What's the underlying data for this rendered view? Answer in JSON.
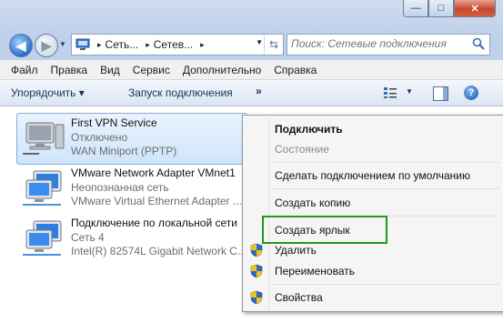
{
  "window": {
    "caption": {
      "minimize": "—",
      "maximize": "□",
      "close": "✕"
    }
  },
  "nav": {
    "back_icon": "arrow-left",
    "forward_icon": "arrow-right"
  },
  "address": {
    "crumbs": [
      "Сеть...",
      "Сетев..."
    ],
    "separator": "▸"
  },
  "search": {
    "placeholder": "Поиск: Сетевые подключения"
  },
  "menubar": [
    "Файл",
    "Правка",
    "Вид",
    "Сервис",
    "Дополнительно",
    "Справка"
  ],
  "commandbar": {
    "organize": "Упорядочить ▾",
    "connect": "Запуск подключения",
    "more": "»"
  },
  "connections": [
    {
      "name": "First VPN Service",
      "status": "Отключено",
      "device": "WAN Miniport (PPTP)",
      "icon": "vpn-computer-icon",
      "selected": true
    },
    {
      "name": "VMware Network Adapter VMnet1",
      "status": "Неопознанная сеть",
      "device": "VMware Virtual Ethernet Adapter ...",
      "icon": "network-adapter-icon",
      "selected": false
    },
    {
      "name": "Подключение по локальной сети",
      "status": "Сеть  4",
      "device": "Intel(R) 82574L Gigabit Network C...",
      "icon": "network-adapter-icon",
      "selected": false
    }
  ],
  "context_menu": {
    "items": [
      {
        "label": "Подключить",
        "bold": true,
        "disabled": false,
        "shield": false
      },
      {
        "label": "Состояние",
        "bold": false,
        "disabled": true,
        "shield": false
      },
      {
        "label": "Сделать подключением по умолчанию",
        "bold": false,
        "disabled": false,
        "shield": false
      },
      {
        "label": "Создать копию",
        "bold": false,
        "disabled": false,
        "shield": false
      },
      {
        "label": "Создать ярлык",
        "bold": false,
        "disabled": false,
        "shield": false
      },
      {
        "label": "Удалить",
        "bold": false,
        "disabled": false,
        "shield": true
      },
      {
        "label": "Переименовать",
        "bold": false,
        "disabled": false,
        "shield": true
      },
      {
        "label": "Свойства",
        "bold": false,
        "disabled": false,
        "shield": true
      }
    ]
  },
  "colors": {
    "highlight_box": "#1c9a22",
    "selection": "#cfe4fb",
    "shield_blue": "#2d6ac4",
    "shield_yellow": "#f2c318"
  }
}
